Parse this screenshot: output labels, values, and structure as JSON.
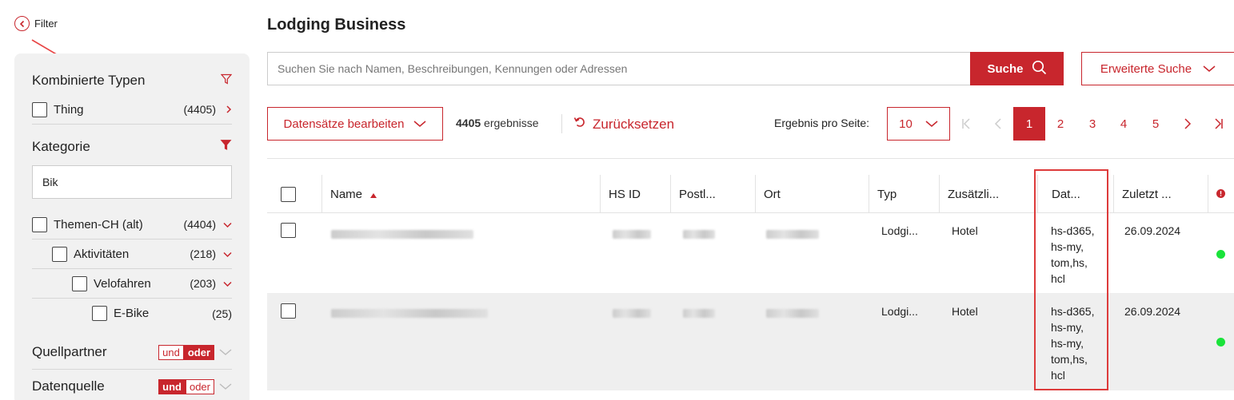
{
  "filter_toggle": {
    "label": "Filter"
  },
  "sidebar": {
    "kombinierte": {
      "title": "Kombinierte Typen",
      "items": [
        {
          "label": "Thing",
          "count": "(4405)"
        }
      ]
    },
    "kategorie": {
      "title": "Kategorie",
      "search_value": "Bik",
      "tree": [
        {
          "label": "Themen-CH (alt)",
          "count": "(4404)",
          "level": 0,
          "expandable": true
        },
        {
          "label": "Aktivitäten",
          "count": "(218)",
          "level": 1,
          "expandable": true
        },
        {
          "label": "Velofahren",
          "count": "(203)",
          "level": 2,
          "expandable": true
        },
        {
          "label": "E-Bike",
          "count": "(25)",
          "level": 3,
          "expandable": false
        }
      ]
    },
    "quellpartner": {
      "title": "Quellpartner",
      "und": "und",
      "oder": "oder"
    },
    "datenquelle": {
      "title": "Datenquelle",
      "und": "und",
      "oder": "oder"
    }
  },
  "main": {
    "title": "Lodging Business",
    "search_placeholder": "Suchen Sie nach Namen, Beschreibungen, Kennungen oder Adressen",
    "search_button": "Suche",
    "advanced_button": "Erweiterte Suche",
    "edit_button": "Datensätze bearbeiten",
    "results_count": "4405",
    "results_label": "ergebnisse",
    "reset_label": "Zurücksetzen",
    "per_page_label": "Ergebnis pro Seite:",
    "per_page_value": "10",
    "pages": [
      "1",
      "2",
      "3",
      "4",
      "5"
    ],
    "current_page": "1"
  },
  "table": {
    "columns": [
      "Name",
      "HS ID",
      "Postl...",
      "Ort",
      "Typ",
      "Zusätzli...",
      "Dat...",
      "Zuletzt ..."
    ],
    "rows": [
      {
        "typ": "Lodgi...",
        "zusatz": "Hotel",
        "dat": [
          "hs-d365,",
          "hs-my,",
          "tom,hs,",
          "hcl"
        ],
        "zuletzt": "26.09.2024"
      },
      {
        "typ": "Lodgi...",
        "zusatz": "Hotel",
        "dat": [
          "hs-d365,",
          "hs-my,",
          "hs-my,",
          "tom,hs,",
          "hcl"
        ],
        "zuletzt": "26.09.2024"
      }
    ]
  },
  "colors": {
    "accent": "#c8262d",
    "status_green": "#1ae33a",
    "annotation": "#dd3b3b"
  }
}
